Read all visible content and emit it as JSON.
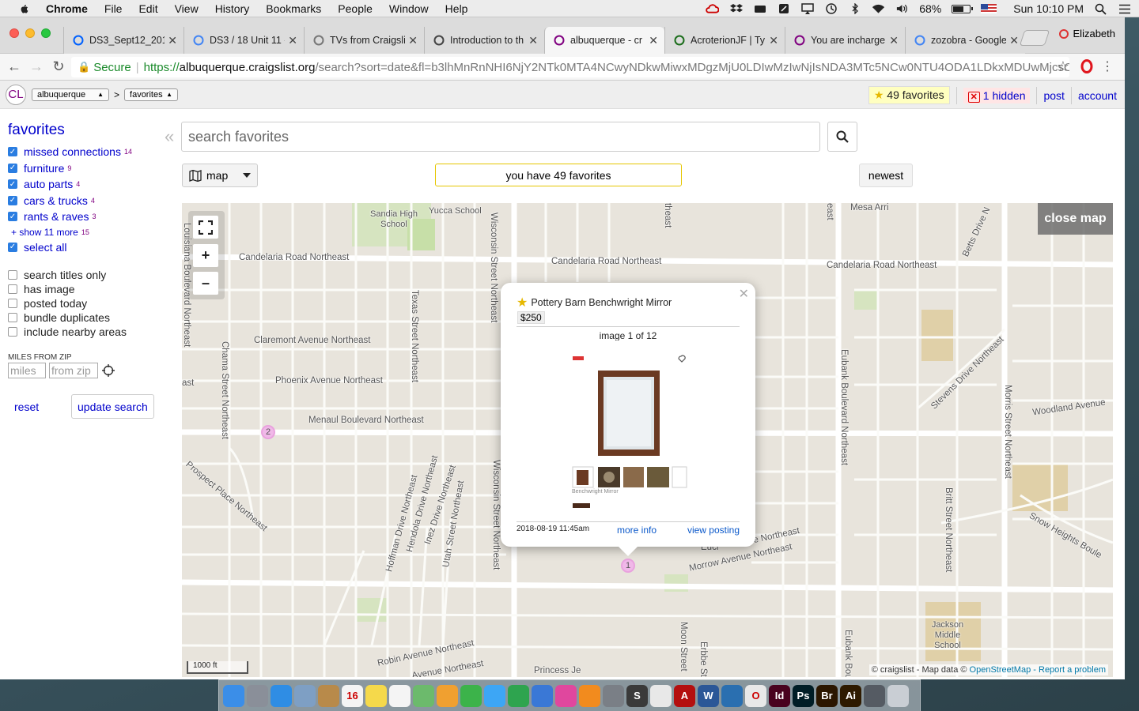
{
  "menubar": {
    "items": [
      "Chrome",
      "File",
      "Edit",
      "View",
      "History",
      "Bookmarks",
      "People",
      "Window",
      "Help"
    ],
    "battery_pct": "68%",
    "battery_level": 0.68,
    "clock": "Sun 10:10 PM"
  },
  "browser": {
    "tabs": [
      {
        "title": "DS3_Sept12_201",
        "icon": "dropbox-icon",
        "color": "#0061fe"
      },
      {
        "title": "DS3 / 18 Unit 11 -",
        "icon": "docs-icon",
        "color": "#4285f4"
      },
      {
        "title": "TVs from Craigsli",
        "icon": "page-icon",
        "color": "#777777"
      },
      {
        "title": "Introduction to th",
        "icon": "book-icon",
        "color": "#444444"
      },
      {
        "title": "albuquerque - cr",
        "icon": "peace-icon",
        "color": "#800080",
        "active": true
      },
      {
        "title": "AcroterionJF | Ty",
        "icon": "tk-icon",
        "color": "#1b6d1b"
      },
      {
        "title": "You are incharge",
        "icon": "peace-icon",
        "color": "#800080"
      },
      {
        "title": "zozobra - Google",
        "icon": "google-icon",
        "color": "#4285f4"
      }
    ],
    "profile_name": "Elizabeth",
    "url_secure_label": "Secure",
    "url_protocol": "https://",
    "url_host": "albuquerque.craigslist.org",
    "url_path": "/search?sort=date&fl=b3lhMnRnNHI6NjY2NTk0MTA4NCwyNDkwMiwxMDgzMjU0LDIwMzIwNjIsNDA3MTc5NCw0NTU4ODA1LDkxMDUwMjcsO..."
  },
  "cl_header": {
    "logo": "CL",
    "area_select": "albuquerque",
    "crumb_sep": ">",
    "section_select": "favorites",
    "favorites_count_label": "49 favorites",
    "hidden_label": "1 hidden",
    "post_label": "post",
    "account_label": "account"
  },
  "sidebar": {
    "title": "favorites",
    "categories": [
      {
        "label": "missed connections",
        "count": "14"
      },
      {
        "label": "furniture",
        "count": "9"
      },
      {
        "label": "auto parts",
        "count": "4"
      },
      {
        "label": "cars & trucks",
        "count": "4"
      },
      {
        "label": "rants & raves",
        "count": "3"
      }
    ],
    "show_more_label": "+ show 11 more",
    "show_more_count": "15",
    "select_all_label": "select all",
    "options": [
      "search titles only",
      "has image",
      "posted today",
      "bundle duplicates",
      "include nearby areas"
    ],
    "miles_label": "MILES FROM ZIP",
    "miles_placeholder": "miles",
    "zip_placeholder": "from zip",
    "reset_label": "reset",
    "update_label": "update search"
  },
  "search": {
    "placeholder": "search favorites",
    "view_label": "map",
    "favorites_notice": "you have 49 favorites",
    "sort_label": "newest"
  },
  "map": {
    "close_label": "close map",
    "scale_label": "1000 ft",
    "attribution_prefix": "© craigslist - Map data ©",
    "attribution_osm": "OpenStreetMap",
    "attribution_sep": "-",
    "attribution_report": "Report a problem",
    "clusters": [
      "2",
      "1"
    ],
    "streets": {
      "candelaria_w": "Candelaria Road Northeast",
      "candelaria_c": "Candelaria Road Northeast",
      "candelaria_e": "Candelaria Road Northeast",
      "claremont": "Claremont Avenue Northeast",
      "phoenix": "Phoenix Avenue Northeast",
      "menaul": "Menaul Boulevard Northeast",
      "prospect": "Prospect Place Northeast",
      "chama": "Chama Street Northeast",
      "texas": "Texas Street Northeast",
      "wisconsin_n": "Wisconsin Street Northeast",
      "wisconsin_s": "Wisconsin Street Northeast",
      "louisiana": "Louisiana Boulevard Northeast",
      "hoffman": "Hoffman Drive Northeast",
      "hendola": "Hendola Drive Northeast",
      "inez": "Inez Drive Northeast",
      "utah": "Utah Street Northeast",
      "eubank": "Eubank Boulevard Northeast",
      "eubank_s": "Eubank Bou",
      "stevens": "Stevens Drive Northeast",
      "morris": "Morris Street Northeast",
      "woodland": "Woodland Avenue",
      "britt": "Britt Street Northeast",
      "snow": "Snow Heights Boule",
      "morrow": "Morrow Avenue Northeast",
      "robin": "Robin Avenue Northeast",
      "avenue_ne": "Avenue Northeast",
      "moon": "Moon Street",
      "erbbe": "Erbbe St",
      "betts": "Betts Drive N",
      "mesa": "Mesa Arri",
      "princess": "Princess Je",
      "sandia": "Sandia High School",
      "yucca": "Yucca School",
      "jackson": "Jackson Middle School",
      "ast": "ast",
      "ne_frag": "e Northeast",
      "eucl": "Eucl",
      "theast": "theast",
      "east": "east"
    }
  },
  "popup": {
    "title": "Pottery Barn Benchwright Mirror",
    "price": "$250",
    "image_count": "image 1 of 12",
    "date": "2018-08-19 11:45am",
    "more_info": "more info",
    "view_posting": "view posting",
    "inner_caption": "Benchwright Mirror"
  },
  "dock": {
    "apps": [
      {
        "name": "finder-icon",
        "color": "#3b8ee8",
        "label": ""
      },
      {
        "name": "launchpad-icon",
        "color": "#8a8f99",
        "label": ""
      },
      {
        "name": "safari-icon",
        "color": "#2f8de4",
        "label": ""
      },
      {
        "name": "preview-icon",
        "color": "#7e9fc4",
        "label": ""
      },
      {
        "name": "contacts-icon",
        "color": "#b88a4a",
        "label": ""
      },
      {
        "name": "calendar-icon",
        "color": "#f4f4f4",
        "label": "16"
      },
      {
        "name": "notes-icon",
        "color": "#f5d94b",
        "label": ""
      },
      {
        "name": "reminders-icon",
        "color": "#f4f4f4",
        "label": ""
      },
      {
        "name": "maps-icon",
        "color": "#6cba6c",
        "label": ""
      },
      {
        "name": "photos-icon",
        "color": "#f0a030",
        "label": ""
      },
      {
        "name": "facetime-icon",
        "color": "#3cb34a",
        "label": ""
      },
      {
        "name": "messages-icon",
        "color": "#3da6f5",
        "label": ""
      },
      {
        "name": "numbers-icon",
        "color": "#2ea44f",
        "label": ""
      },
      {
        "name": "keynote-icon",
        "color": "#3a78d6",
        "label": ""
      },
      {
        "name": "itunes-icon",
        "color": "#e0479e",
        "label": ""
      },
      {
        "name": "ibooks-icon",
        "color": "#f28b1e",
        "label": ""
      },
      {
        "name": "system-preferences-icon",
        "color": "#7a7f86",
        "label": ""
      },
      {
        "name": "sublime-icon",
        "color": "#3a3a3a",
        "label": "S"
      },
      {
        "name": "chrome-icon",
        "color": "#e8e8e8",
        "label": ""
      },
      {
        "name": "acrobat-icon",
        "color": "#b40f0f",
        "label": "A"
      },
      {
        "name": "word-icon",
        "color": "#2b5797",
        "label": "W"
      },
      {
        "name": "text-editor-icon",
        "color": "#2a6fb0",
        "label": ""
      },
      {
        "name": "opera-icon",
        "color": "#e8e8e8",
        "label": "O"
      },
      {
        "name": "indesign-icon",
        "color": "#49021f",
        "label": "Id"
      },
      {
        "name": "photoshop-icon",
        "color": "#001d26",
        "label": "Ps"
      },
      {
        "name": "bridge-icon",
        "color": "#2b1600",
        "label": "Br"
      },
      {
        "name": "illustrator-icon",
        "color": "#2e1a00",
        "label": "Ai"
      },
      {
        "name": "downloads-icon",
        "color": "#555b63",
        "label": ""
      },
      {
        "name": "trash-icon",
        "color": "#c9ced4",
        "label": ""
      }
    ]
  }
}
